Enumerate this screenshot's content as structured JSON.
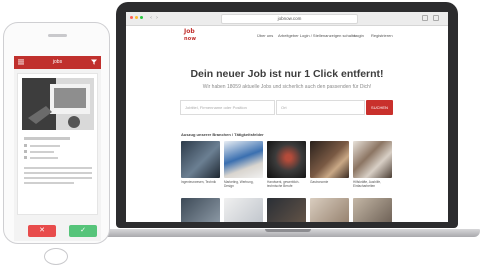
{
  "browser": {
    "url": "jobnow.com",
    "back_glyph": "‹",
    "forward_glyph": "›"
  },
  "site": {
    "logo_top": "Job",
    "logo_bottom": "now",
    "brand_color": "#c0302d",
    "nav": [
      "Über uns",
      "Arbeitgeber Login / Stellenanzeigen schalten",
      "Login",
      "Registrieren"
    ]
  },
  "hero": {
    "title": "Dein neuer Job ist nur 1 Click entfernt!",
    "subtitle": "Wir haben 18059 aktuelle Jobs und sicherlich auch den passenden für Dich!",
    "keyword_placeholder": "Jobtitel, Firmenname oder Position",
    "location_placeholder": "Ort",
    "search_button": "SUCHEN"
  },
  "categories": {
    "heading": "Auszug unserer Branchen / Tätigkeitsfelder",
    "row1": [
      {
        "label": "Ingenieurwesen, Technik",
        "icon": "engineering-photo"
      },
      {
        "label": "Marketing, Werbung, Design",
        "icon": "marketing-photo"
      },
      {
        "label": "Handwerk, gewerblich-technische Berufe",
        "icon": "craft-photo"
      },
      {
        "label": "Gastronomie",
        "icon": "gastronomy-photo"
      },
      {
        "label": "Hilfskräfte, Aushilfe, Einfacharbeiten",
        "icon": "helper-photo"
      }
    ]
  },
  "phone": {
    "app_title": "jobs",
    "dislike_glyph": "✕",
    "like_glyph": "✓",
    "dislike_color": "#e84c4c",
    "like_color": "#56c47a"
  }
}
